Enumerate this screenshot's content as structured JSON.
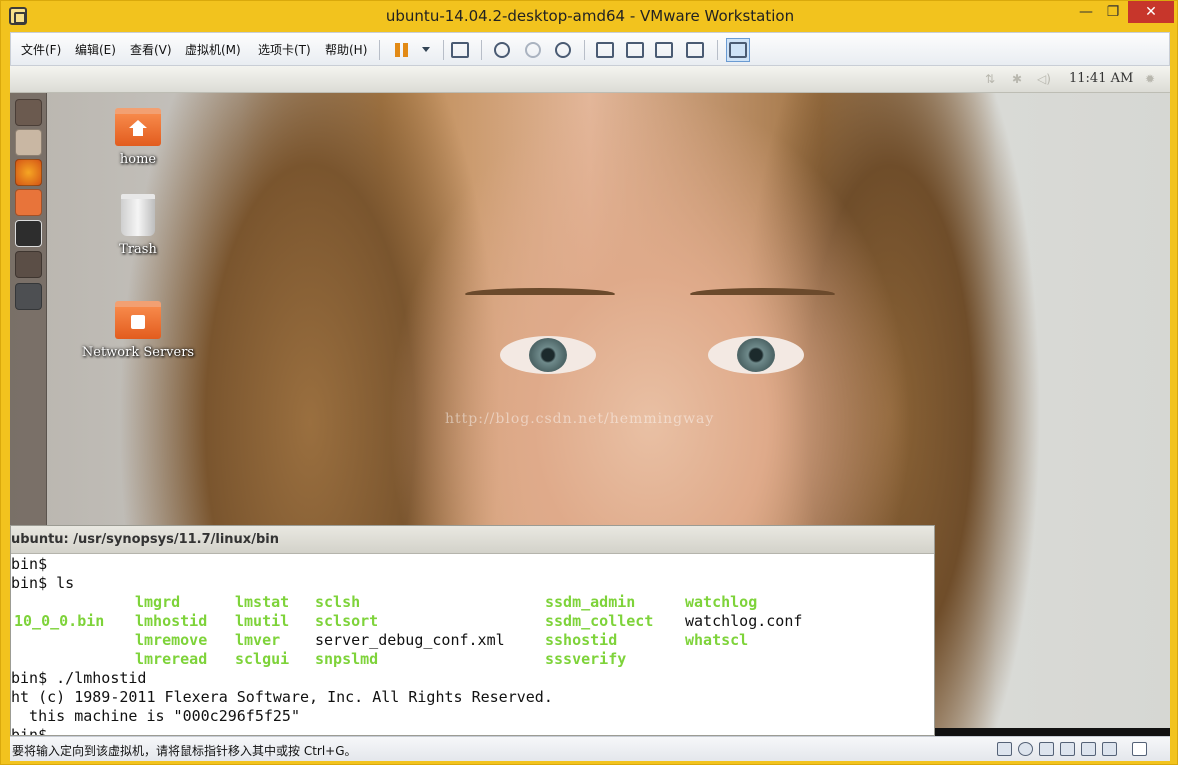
{
  "window": {
    "title": "ubuntu-14.04.2-desktop-amd64 - VMware Workstation",
    "min_glyph": "—",
    "max_glyph": "❐",
    "close_glyph": "✕"
  },
  "menu": {
    "items": [
      "文件(F)",
      "编辑(E)",
      "查看(V)",
      "虚拟机(M)",
      "选项卡(T)",
      "帮助(H)"
    ]
  },
  "toolbar": {
    "icons": [
      "pause-icon",
      "dropdown-icon",
      "send-keys-icon",
      "snapshot-icon",
      "revert-snapshot-icon",
      "snapshot-manager-icon",
      "sidebar-icon",
      "console-icon",
      "fullscreen-icon",
      "unity-icon",
      "thumbnail-view-icon"
    ]
  },
  "ubuntu_panel": {
    "clock": "11:41 AM",
    "tray_icons": [
      "network-icon",
      "bluetooth-icon",
      "volume-icon",
      "gear-icon"
    ]
  },
  "desktop": {
    "icons": [
      {
        "label": "home",
        "kind": "home-folder-icon"
      },
      {
        "label": "Trash",
        "kind": "trash-icon"
      },
      {
        "label": "Network Servers",
        "kind": "network-folder-icon"
      }
    ],
    "watermark": "http://blog.csdn.net/hemmingway"
  },
  "launcher": {
    "items": [
      "dash-icon",
      "files-icon",
      "firefox-icon",
      "software-center-icon",
      "terminal-icon",
      "workspace-icon",
      "save-icon",
      "disk-icon"
    ]
  },
  "terminal": {
    "title": "ubuntu: /usr/synopsys/11.7/linux/bin",
    "prompt1": "bin$",
    "prompt2": "bin$ ls",
    "ls_col1": [
      "",
      "10_0_0.bin",
      "",
      ""
    ],
    "ls_col2": [
      "lmgrd",
      "lmhostid",
      "lmremove",
      "lmreread"
    ],
    "ls_col3": [
      "lmstat",
      "lmutil",
      "lmver",
      "sclgui"
    ],
    "ls_col4": [
      "sclsh",
      "sclsort",
      "server_debug_conf.xml",
      "snpslmd"
    ],
    "ls_col5": [
      "ssdm_admin",
      "ssdm_collect",
      "sshostid",
      "sssverify"
    ],
    "ls_col6": [
      "watchlog",
      "watchlog.conf",
      "whatscl",
      ""
    ],
    "plain_entries": [
      "server_debug_conf.xml",
      "watchlog.conf"
    ],
    "cmd_line": "bin$ ./lmhostid",
    "copyright": "ht (c) 1989-2011 Flexera Software, Inc. All Rights Reserved.",
    "hostid_line": "  this machine is \"000c296f5f25\"",
    "last_prompt": "bin$"
  },
  "statusbar": {
    "text": "要将输入定向到该虚拟机，请将鼠标指针移入其中或按 Ctrl+G。",
    "icons": [
      "hdd-icon",
      "cd-icon",
      "network-adapter-icon",
      "usb-icon",
      "printer-icon",
      "sound-icon",
      "display-icon",
      "message-icon"
    ]
  },
  "colors": {
    "frame": "#f2c31e",
    "terminal_bold": "#7ed33a",
    "close_button": "#c7362b"
  }
}
